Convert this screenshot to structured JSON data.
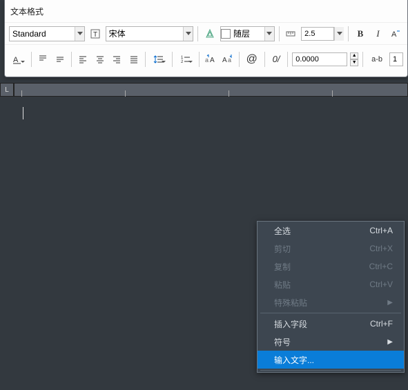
{
  "format_panel": {
    "title": "文本格式",
    "style_combo": "Standard",
    "font_combo": "宋体",
    "color_layer": "随层",
    "lineweight": "2.5",
    "bold": "B",
    "italic": "I",
    "tracking": "0.0000",
    "abc_label": "a-b",
    "one": "1",
    "at": "@",
    "zero": "0",
    "slash": "/"
  },
  "ruler": {
    "corner": "L"
  },
  "context_menu": {
    "items": [
      {
        "label": "全选",
        "shortcut": "Ctrl+A",
        "enabled": true
      },
      {
        "label": "剪切",
        "shortcut": "Ctrl+X",
        "enabled": false
      },
      {
        "label": "复制",
        "shortcut": "Ctrl+C",
        "enabled": false
      },
      {
        "label": "粘贴",
        "shortcut": "Ctrl+V",
        "enabled": false
      },
      {
        "label": "特殊粘贴",
        "shortcut": "",
        "enabled": false,
        "submenu": true
      }
    ],
    "items2": [
      {
        "label": "插入字段",
        "shortcut": "Ctrl+F"
      },
      {
        "label": "符号",
        "shortcut": "",
        "submenu": true
      }
    ],
    "selected": {
      "label": "输入文字..."
    }
  }
}
